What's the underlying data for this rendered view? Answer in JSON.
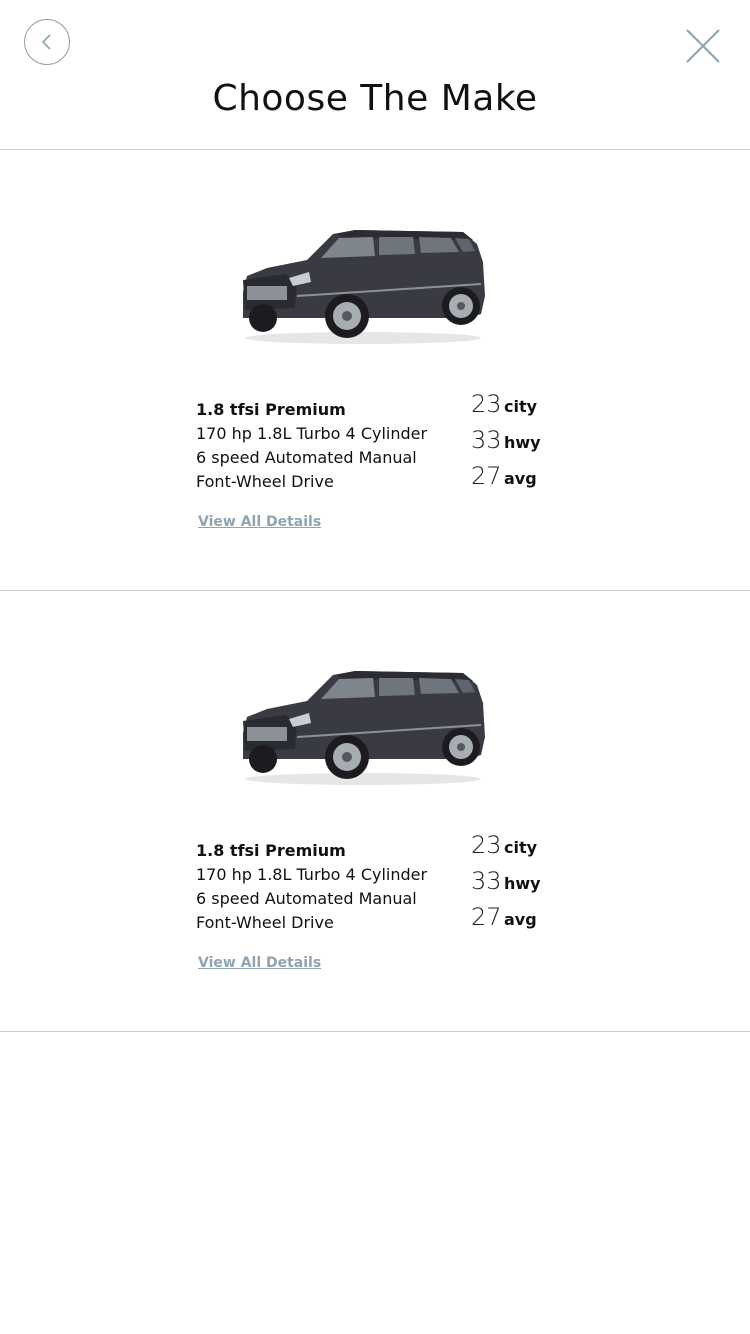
{
  "header": {
    "title": "Choose The Make",
    "back_icon": "chevron-left-icon",
    "close_icon": "close-icon",
    "accent_color": "#8fa3b0"
  },
  "vehicles": [
    {
      "image_icon": "suv-image",
      "trim": "1.8 tfsi Premium",
      "specs": [
        "170 hp 1.8L Turbo 4 Cylinder",
        "6 speed Automated Manual",
        "Font-Wheel Drive"
      ],
      "mpg": [
        {
          "value": "23",
          "unit": "city"
        },
        {
          "value": "33",
          "unit": "hwy"
        },
        {
          "value": "27",
          "unit": "avg"
        }
      ],
      "details_label": "View All Details"
    },
    {
      "image_icon": "suv-image",
      "trim": "1.8 tfsi Premium",
      "specs": [
        "170 hp 1.8L Turbo 4 Cylinder",
        "6 speed Automated Manual",
        "Font-Wheel Drive"
      ],
      "mpg": [
        {
          "value": "23",
          "unit": "city"
        },
        {
          "value": "33",
          "unit": "hwy"
        },
        {
          "value": "27",
          "unit": "avg"
        }
      ],
      "details_label": "View All Details"
    }
  ]
}
